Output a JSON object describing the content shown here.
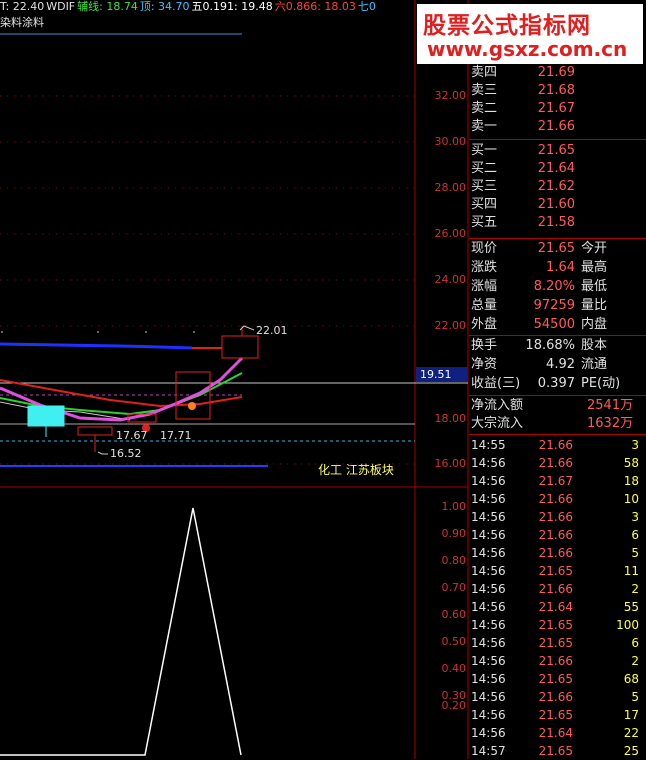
{
  "topbar": [
    {
      "text": "T: 22.40",
      "color": "#e0e0e0"
    },
    {
      "text": "WDIF",
      "color": "#e0e0e0"
    },
    {
      "text": "辅线: 18.74",
      "color": "#40e040"
    },
    {
      "text": "顶: 34.70",
      "color": "#40c0ff"
    },
    {
      "text": "五0.191: 19.48",
      "color": "#ffffff"
    },
    {
      "text": "六0.866: 18.03",
      "color": "#ff4040"
    },
    {
      "text": "七0",
      "color": "#40c0ff"
    }
  ],
  "stock_name": "染料涂料",
  "price_axis": [
    "32.00",
    "30.00",
    "28.00",
    "26.00",
    "24.00",
    "22.00",
    "18.00",
    "16.00"
  ],
  "current_price_tag": "19.51",
  "sub_axis": [
    "1.00",
    "0.90",
    "0.80",
    "0.70",
    "0.60",
    "0.50",
    "0.40",
    "0.30",
    "0.20"
  ],
  "annotations": {
    "high": "22.01",
    "low": "16.52",
    "mid": "17.67",
    "mid2": "17.71",
    "sector": "化工 江苏板块"
  },
  "watermark": {
    "title": "股票公式指标网",
    "url": "www.gsxz.com.cn"
  },
  "sell_orders": [
    {
      "label": "卖四",
      "price": "21.69"
    },
    {
      "label": "卖三",
      "price": "21.68"
    },
    {
      "label": "卖二",
      "price": "21.67"
    },
    {
      "label": "卖一",
      "price": "21.66"
    }
  ],
  "buy_orders": [
    {
      "label": "买一",
      "price": "21.65"
    },
    {
      "label": "买二",
      "price": "21.64"
    },
    {
      "label": "买三",
      "price": "21.62"
    },
    {
      "label": "买四",
      "price": "21.60"
    },
    {
      "label": "买五",
      "price": "21.58"
    }
  ],
  "quote": [
    {
      "label": "现价",
      "value": "21.65",
      "label2": "今开"
    },
    {
      "label": "涨跌",
      "value": "1.64",
      "label2": "最高"
    },
    {
      "label": "涨幅",
      "value": "8.20%",
      "label2": "最低"
    },
    {
      "label": "总量",
      "value": "97259",
      "label2": "量比"
    },
    {
      "label": "外盘",
      "value": "54500",
      "label2": "内盘"
    }
  ],
  "stats": [
    {
      "label": "换手",
      "value": "18.68%",
      "label2": "股本"
    },
    {
      "label": "净资",
      "value": "4.92",
      "label2": "流通"
    },
    {
      "label": "收益(三)",
      "value": "0.397",
      "label2": "PE(动)"
    }
  ],
  "flow": [
    {
      "label": "净流入额",
      "value": "2541万"
    },
    {
      "label": "大宗流入",
      "value": "1632万"
    }
  ],
  "ticks": [
    {
      "time": "14:55",
      "price": "21.66",
      "vol": "3"
    },
    {
      "time": "14:56",
      "price": "21.66",
      "vol": "58"
    },
    {
      "time": "14:56",
      "price": "21.67",
      "vol": "18"
    },
    {
      "time": "14:56",
      "price": "21.66",
      "vol": "10"
    },
    {
      "time": "14:56",
      "price": "21.66",
      "vol": "3"
    },
    {
      "time": "14:56",
      "price": "21.66",
      "vol": "6"
    },
    {
      "time": "14:56",
      "price": "21.66",
      "vol": "5"
    },
    {
      "time": "14:56",
      "price": "21.65",
      "vol": "11"
    },
    {
      "time": "14:56",
      "price": "21.66",
      "vol": "2"
    },
    {
      "time": "14:56",
      "price": "21.64",
      "vol": "55"
    },
    {
      "time": "14:56",
      "price": "21.65",
      "vol": "100"
    },
    {
      "time": "14:56",
      "price": "21.65",
      "vol": "6"
    },
    {
      "time": "14:56",
      "price": "21.66",
      "vol": "2"
    },
    {
      "time": "14:56",
      "price": "21.65",
      "vol": "68"
    },
    {
      "time": "14:56",
      "price": "21.66",
      "vol": "5"
    },
    {
      "time": "14:56",
      "price": "21.65",
      "vol": "17"
    },
    {
      "time": "14:56",
      "price": "21.64",
      "vol": "22"
    },
    {
      "time": "14:57",
      "price": "21.65",
      "vol": "25"
    }
  ]
}
